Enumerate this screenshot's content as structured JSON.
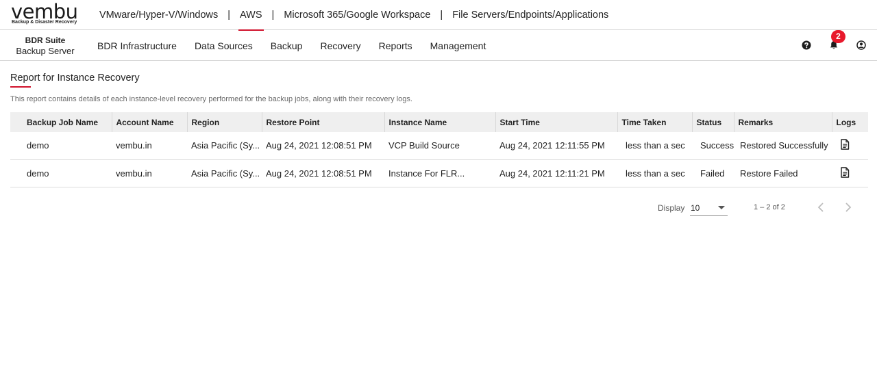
{
  "logo": {
    "word": "vembu",
    "tagline": "Backup & Disaster Recovery"
  },
  "product_tabs": [
    {
      "label": "VMware/Hyper-V/Windows",
      "active": false
    },
    {
      "label": "AWS",
      "active": true
    },
    {
      "label": "Microsoft 365/Google Workspace",
      "active": false
    },
    {
      "label": "File Servers/Endpoints/Applications",
      "active": false
    }
  ],
  "separator": "|",
  "brand": {
    "line1": "BDR Suite",
    "line2": "Backup Server"
  },
  "menu": [
    {
      "label": "BDR Infrastructure"
    },
    {
      "label": "Data Sources"
    },
    {
      "label": "Backup"
    },
    {
      "label": "Recovery"
    },
    {
      "label": "Reports"
    },
    {
      "label": "Management"
    }
  ],
  "icons": {
    "help": "help-icon",
    "notifications": "bell-icon",
    "user": "user-icon",
    "log": "document-icon",
    "prev": "chevron-left-icon",
    "next": "chevron-right-icon",
    "caret": "caret-down-icon"
  },
  "notification_count": "2",
  "accent_color": "#d0112b",
  "page": {
    "title": "Report for Instance Recovery",
    "description": "This report contains details of each instance-level recovery performed for the backup jobs, along with their recovery logs."
  },
  "table": {
    "columns": [
      "Backup Job Name",
      "Account Name",
      "Region",
      "Restore Point",
      "Instance Name",
      "Start Time",
      "Time Taken",
      "Status",
      "Remarks",
      "Logs"
    ],
    "rows": [
      {
        "job": "demo",
        "account": "vembu.in",
        "region": "Asia Pacific (Sy...",
        "restore_point": "Aug 24, 2021 12:08:51 PM",
        "instance": "VCP Build Source",
        "start_time": "Aug 24, 2021 12:11:55 PM",
        "time_taken": "less than a sec",
        "status": "Success",
        "remarks": "Restored Successfully"
      },
      {
        "job": "demo",
        "account": "vembu.in",
        "region": "Asia Pacific (Sy...",
        "restore_point": "Aug 24, 2021 12:08:51 PM",
        "instance": "Instance For FLR...",
        "start_time": "Aug 24, 2021 12:11:21 PM",
        "time_taken": "less than a sec",
        "status": "Failed",
        "remarks": "Restore Failed"
      }
    ]
  },
  "pagination": {
    "display_label": "Display",
    "page_size": "10",
    "range": "1 – 2 of 2"
  }
}
